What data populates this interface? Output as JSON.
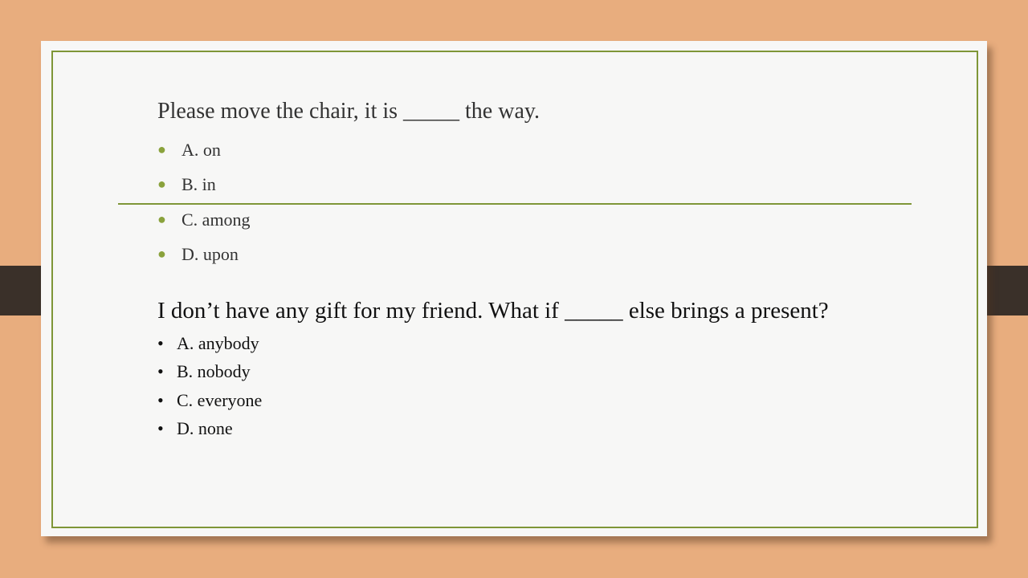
{
  "question1": {
    "text": "Please move the chair, it is _____ the way.",
    "options": [
      "A. on",
      "B. in",
      "C. among",
      "D. upon"
    ]
  },
  "question2": {
    "text": "I don’t have any gift for my friend. What if _____ else brings a present?",
    "options": [
      "A. anybody",
      "B. nobody",
      "C. everyone",
      "D. none"
    ]
  },
  "colors": {
    "background": "#e8ad7e",
    "accent": "#7f9637",
    "tab": "#3a3029"
  }
}
